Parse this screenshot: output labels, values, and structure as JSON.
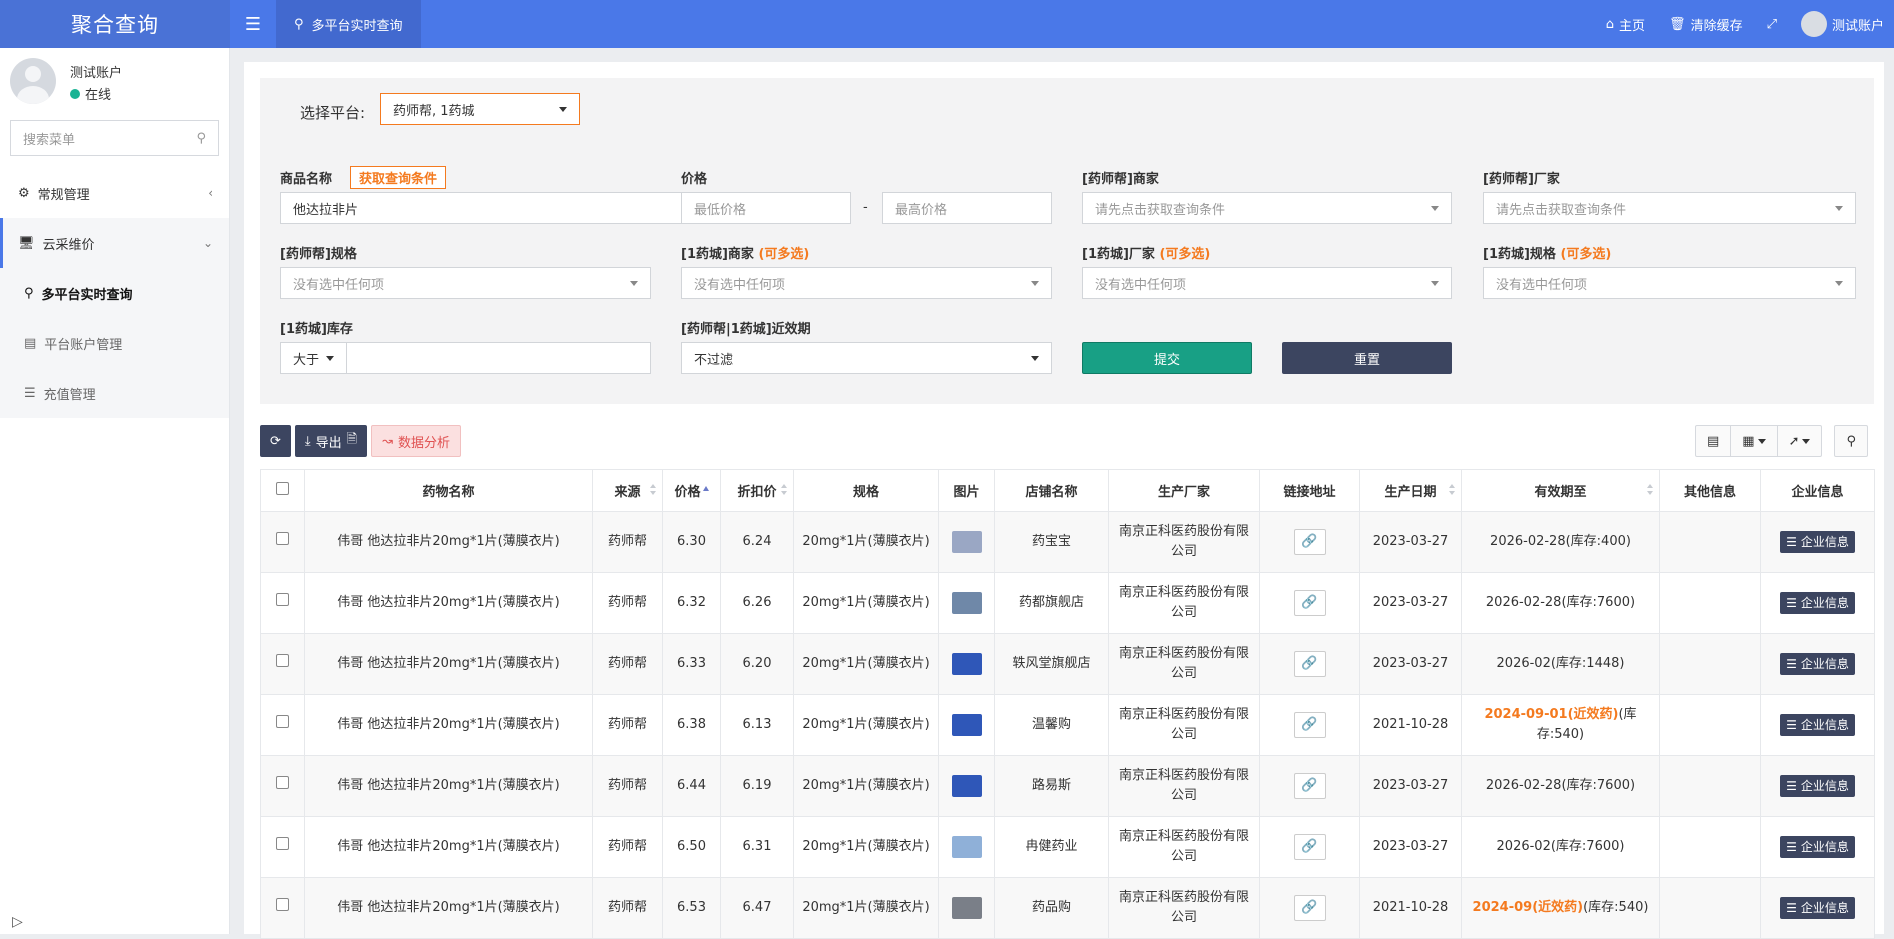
{
  "header": {
    "brand": "聚合查询",
    "active_tab": "多平台实时查询",
    "home": "主页",
    "clear_cache": "清除缓存",
    "account": "测试账户"
  },
  "sidebar": {
    "user_name": "测试账户",
    "status": "在线",
    "search_placeholder": "搜索菜单",
    "menu": [
      {
        "label": "常规管理"
      },
      {
        "label": "云采维价"
      }
    ],
    "submenu": [
      {
        "label": "多平台实时查询"
      },
      {
        "label": "平台账户管理"
      },
      {
        "label": "充值管理"
      }
    ]
  },
  "form": {
    "platform_label": "选择平台:",
    "platform_value": "药师帮, 1药城",
    "product_label": "商品名称",
    "fetch_btn": "获取查询条件",
    "product_value": "他达拉非片",
    "price_label": "价格",
    "min_price_ph": "最低价格",
    "max_price_ph": "最高价格",
    "price_dash": "-",
    "ysb_merchant_label": "[药师帮]商家",
    "ysb_merchant_ph": "请先点击获取查询条件",
    "ysb_factory_label": "[药师帮]厂家",
    "ysb_factory_ph": "请先点击获取查询条件",
    "ysb_spec_label": "[药师帮]规格",
    "none_selected": "没有选中任何项",
    "yyc_merchant_label": "[1药城]商家",
    "yyc_factory_label": "[1药城]厂家",
    "yyc_spec_label": "[1药城]规格",
    "multi": "(可多选)",
    "stock_label": "[1药城]库存",
    "stock_op": "大于",
    "expiry_label": "[药师帮|1药城]近效期",
    "expiry_value": "不过滤",
    "submit": "提交",
    "reset": "重置"
  },
  "toolbar": {
    "export": "导出",
    "analysis": "数据分析"
  },
  "table": {
    "headers": [
      "药物名称",
      "来源",
      "价格",
      "折扣价",
      "规格",
      "图片",
      "店铺名称",
      "生产厂家",
      "链接地址",
      "生产日期",
      "有效期至",
      "其他信息",
      "企业信息"
    ],
    "corp_btn": "企业信息",
    "rows": [
      {
        "name": "伟哥 他达拉非片20mg*1片(薄膜衣片)",
        "source": "药师帮",
        "price": "6.30",
        "discount": "6.24",
        "spec": "20mg*1片(薄膜衣片)",
        "shop": "药宝宝",
        "maker": "南京正科医药股份有限公司",
        "prod_date": "2023-03-27",
        "expiry_warn": "",
        "expiry": "2026-02-28(库存:400)",
        "img_color": "#9aa7c4"
      },
      {
        "name": "伟哥 他达拉非片20mg*1片(薄膜衣片)",
        "source": "药师帮",
        "price": "6.32",
        "discount": "6.26",
        "spec": "20mg*1片(薄膜衣片)",
        "shop": "药都旗舰店",
        "maker": "南京正科医药股份有限公司",
        "prod_date": "2023-03-27",
        "expiry_warn": "",
        "expiry": "2026-02-28(库存:7600)",
        "img_color": "#6f88a8"
      },
      {
        "name": "伟哥 他达拉非片20mg*1片(薄膜衣片)",
        "source": "药师帮",
        "price": "6.33",
        "discount": "6.20",
        "spec": "20mg*1片(薄膜衣片)",
        "shop": "轶风堂旗舰店",
        "maker": "南京正科医药股份有限公司",
        "prod_date": "2023-03-27",
        "expiry_warn": "",
        "expiry": "2026-02(库存:1448)",
        "img_color": "#2f57b8"
      },
      {
        "name": "伟哥 他达拉非片20mg*1片(薄膜衣片)",
        "source": "药师帮",
        "price": "6.38",
        "discount": "6.13",
        "spec": "20mg*1片(薄膜衣片)",
        "shop": "温馨购",
        "maker": "南京正科医药股份有限公司",
        "prod_date": "2021-10-28",
        "expiry_warn": "2024-09-01(近效药)",
        "expiry": "(库存:540)",
        "img_color": "#2f57b8"
      },
      {
        "name": "伟哥 他达拉非片20mg*1片(薄膜衣片)",
        "source": "药师帮",
        "price": "6.44",
        "discount": "6.19",
        "spec": "20mg*1片(薄膜衣片)",
        "shop": "路易斯",
        "maker": "南京正科医药股份有限公司",
        "prod_date": "2023-03-27",
        "expiry_warn": "",
        "expiry": "2026-02-28(库存:7600)",
        "img_color": "#2f57b8"
      },
      {
        "name": "伟哥 他达拉非片20mg*1片(薄膜衣片)",
        "source": "药师帮",
        "price": "6.50",
        "discount": "6.31",
        "spec": "20mg*1片(薄膜衣片)",
        "shop": "冉健药业",
        "maker": "南京正科医药股份有限公司",
        "prod_date": "2023-03-27",
        "expiry_warn": "",
        "expiry": "2026-02(库存:7600)",
        "img_color": "#8fb0d8"
      },
      {
        "name": "伟哥 他达拉非片20mg*1片(薄膜衣片)",
        "source": "药师帮",
        "price": "6.53",
        "discount": "6.47",
        "spec": "20mg*1片(薄膜衣片)",
        "shop": "药品购",
        "maker": "南京正科医药股份有限公司",
        "prod_date": "2021-10-28",
        "expiry_warn": "2024-09(近效药)",
        "expiry": "(库存:540)",
        "img_color": "#7a7f88"
      }
    ]
  }
}
